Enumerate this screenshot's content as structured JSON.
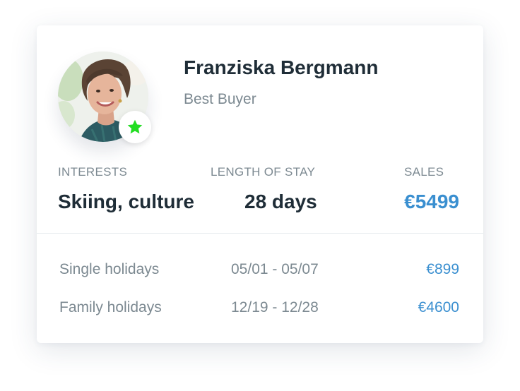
{
  "profile": {
    "name": "Franziska Bergmann",
    "role": "Best Buyer",
    "avatar_icon": "person-portrait",
    "badge_icon": "star-icon",
    "badge_color": "#22dd22"
  },
  "stats": [
    {
      "label": "INTERESTS",
      "value": "Skiing, culture"
    },
    {
      "label": "LENGTH OF STAY",
      "value": "28 days"
    },
    {
      "label": "SALES",
      "value": "€5499"
    }
  ],
  "bookings": [
    {
      "category": "Single holidays",
      "dates": "05/01 - 05/07",
      "amount": "€899"
    },
    {
      "category": "Family holidays",
      "dates": "12/19 - 12/28",
      "amount": "€4600"
    }
  ],
  "colors": {
    "text_dark": "#1f2d37",
    "text_muted": "#7c8991",
    "accent": "#3a8fd0"
  }
}
